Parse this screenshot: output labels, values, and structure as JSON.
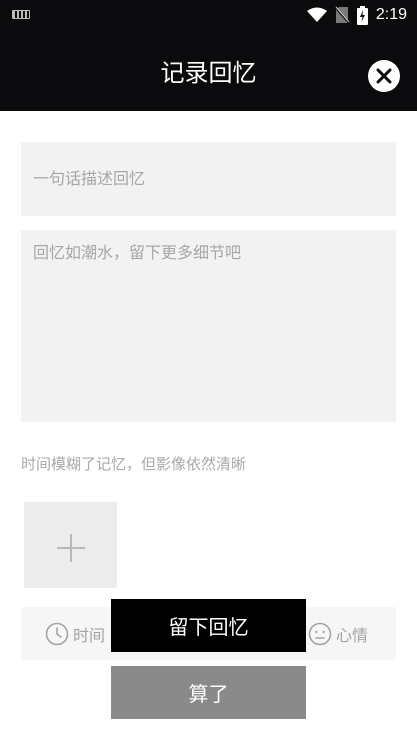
{
  "status_bar": {
    "time": "2:19"
  },
  "header": {
    "title": "记录回忆"
  },
  "form": {
    "title_placeholder": "一句话描述回忆",
    "detail_placeholder": "回忆如潮水，留下更多细节吧",
    "photo_hint": "时间模糊了记忆，但影像依然清晰"
  },
  "meta": {
    "time_label": "时间",
    "mood_label": "心情"
  },
  "actions": {
    "confirm_label": "留下回忆",
    "cancel_label": "算了"
  },
  "colors": {
    "header_bg": "#0b0b0d",
    "field_bg": "#f2f2f2",
    "primary_button_bg": "#000000",
    "secondary_button_bg": "#8a8a8a"
  }
}
